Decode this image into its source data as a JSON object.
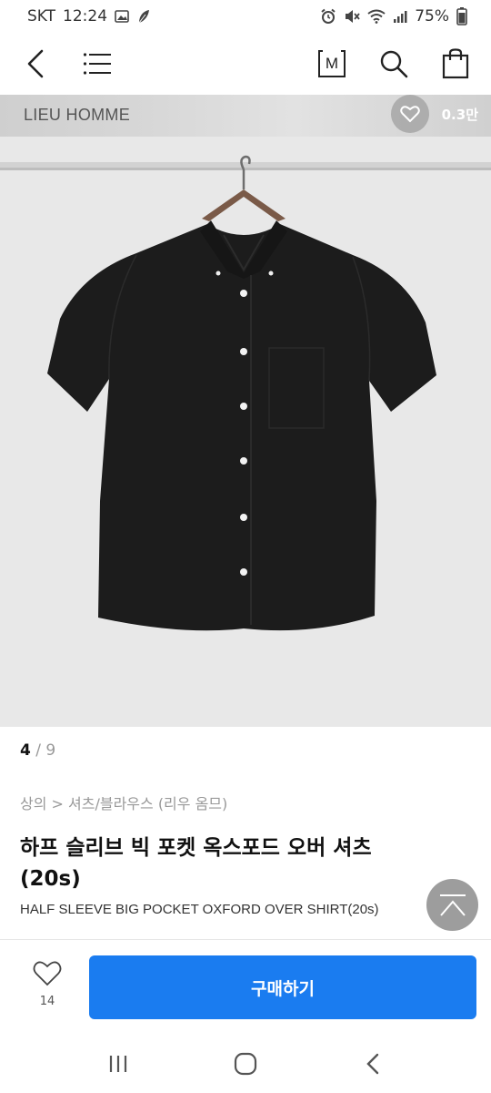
{
  "status_bar": {
    "carrier": "SKT",
    "time": "12:24",
    "battery": "75%",
    "icons": [
      "image-icon",
      "leaf-icon",
      "alarm-icon",
      "mute-icon",
      "wifi-icon",
      "signal-icon",
      "battery-icon"
    ]
  },
  "header": {
    "icons": [
      "back-icon",
      "menu-icon",
      "m-badge-icon",
      "search-icon",
      "shopping-bag-icon"
    ],
    "m_badge_label": "M"
  },
  "image": {
    "brand": "LIEU HOMME",
    "like_count": "0.3만",
    "background": "#e7e7e7",
    "shirt_color": "#1c1c1c"
  },
  "pager": {
    "current": "4",
    "separator": "/",
    "total": "9"
  },
  "breadcrumb": "상의 > 셔츠/블라우스 (리우 옴므)",
  "product": {
    "title": "하프 슬리브 빅 포켓 옥스포드 오버 셔츠 (20s)",
    "subtitle": "HALF SLEEVE BIG POCKET OXFORD OVER SHIRT(20s)"
  },
  "buy_bar": {
    "wish_count": "14",
    "buy_label": "구매하기",
    "accent": "#1a7cf0"
  },
  "nav_bar": {
    "icons": [
      "recent-apps-icon",
      "home-icon",
      "back-nav-icon"
    ]
  }
}
